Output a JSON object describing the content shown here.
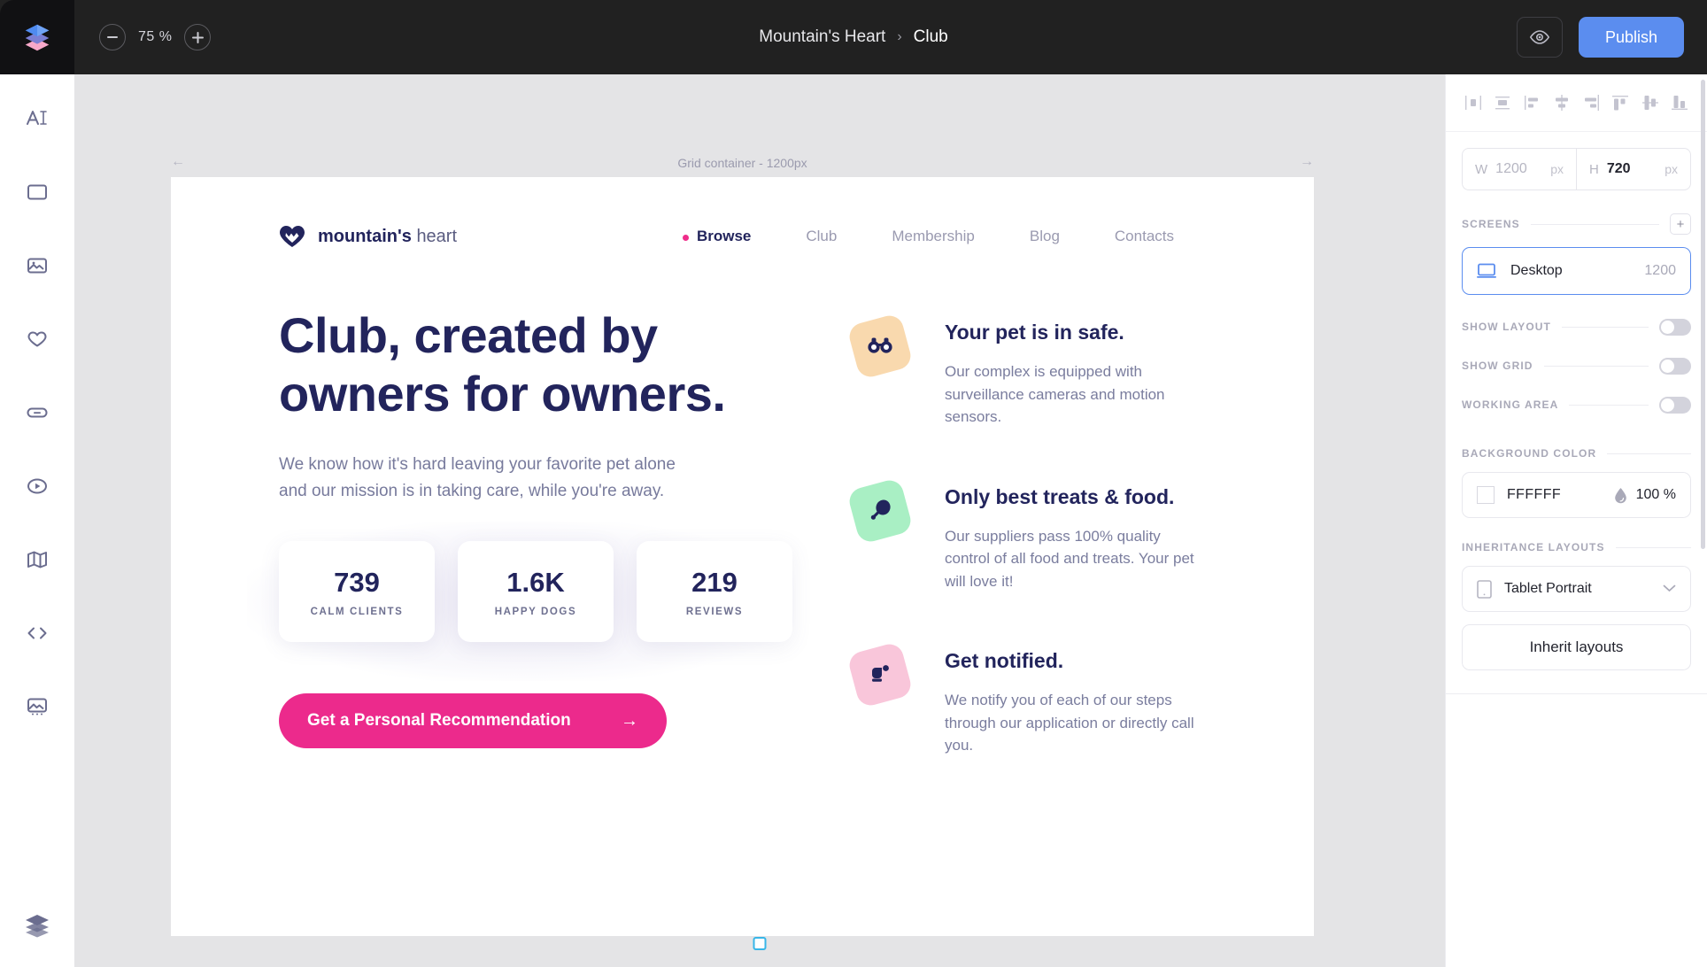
{
  "topbar": {
    "logo_icon": "layers-logo-icon",
    "zoom_out_icon": "minus-icon",
    "zoom_in_icon": "plus-icon",
    "zoom_value": "75 %",
    "breadcrumb_parent": "Mountain's Heart",
    "breadcrumb_separator": "›",
    "breadcrumb_current": "Club",
    "preview_icon": "eye-icon",
    "publish_label": "Publish"
  },
  "rail": {
    "items": [
      {
        "icon": "text-tool-icon",
        "name": "text"
      },
      {
        "icon": "block-tool-icon",
        "name": "block"
      },
      {
        "icon": "image-tool-icon",
        "name": "image"
      },
      {
        "icon": "shape-heart-tool-icon",
        "name": "shape"
      },
      {
        "icon": "button-tool-icon",
        "name": "button"
      },
      {
        "icon": "video-tool-icon",
        "name": "video"
      },
      {
        "icon": "map-tool-icon",
        "name": "map"
      },
      {
        "icon": "code-tool-icon",
        "name": "code"
      },
      {
        "icon": "gallery-tool-icon",
        "name": "gallery"
      }
    ],
    "bottom_icon": "layers-icon"
  },
  "canvas": {
    "ruler_label": "Grid container - 1200px",
    "arrow_left": "←",
    "arrow_right": "→"
  },
  "site": {
    "logo_mark": "heart-mountain-logo-icon",
    "logo_bold": "mountain's",
    "logo_light": "heart",
    "nav": [
      {
        "label": "Browse",
        "active": true
      },
      {
        "label": "Club",
        "active": false
      },
      {
        "label": "Membership",
        "active": false
      },
      {
        "label": "Blog",
        "active": false
      },
      {
        "label": "Contacts",
        "active": false
      }
    ],
    "hero": {
      "heading_line1": "Club, created by",
      "heading_line2": "owners for owners.",
      "paragraph": "We know how it's hard leaving your favorite pet alone and our mission is in taking care, while you're away.",
      "cta_label": "Get a Personal Recommendation",
      "cta_arrow": "→"
    },
    "stats": [
      {
        "number": "739",
        "label": "CALM CLIENTS"
      },
      {
        "number": "1.6K",
        "label": "HAPPY DOGS"
      },
      {
        "number": "219",
        "label": "REVIEWS"
      }
    ],
    "features": [
      {
        "icon": "binoculars-icon",
        "badge_color": "#f9d9ae",
        "title": "Your pet is in safe.",
        "desc": "Our complex is equipped with surveillance cameras and motion sensors."
      },
      {
        "icon": "drumstick-icon",
        "badge_color": "#a9efc4",
        "title": "Only best treats & food.",
        "desc": "Our suppliers pass 100% quality control of all food and treats. Your pet will love it!"
      },
      {
        "icon": "bell-notification-icon",
        "badge_color": "#f9c6da",
        "title": "Get notified.",
        "desc": "We notify you of each of our steps through our application or directly call you."
      }
    ]
  },
  "panel": {
    "align_icons": [
      "align-left-icon",
      "align-center-horizontal-icon",
      "align-right-icon",
      "distribute-horizontal-icon",
      "align-edge-right-icon",
      "align-top-icon",
      "align-middle-vertical-icon",
      "align-bottom-icon"
    ],
    "size": {
      "width_key": "W",
      "width_value": "1200",
      "width_unit": "px",
      "height_key": "H",
      "height_value": "720",
      "height_unit": "px"
    },
    "screens": {
      "title": "SCREENS",
      "add_icon": "plus-icon",
      "items": [
        {
          "icon": "desktop-icon",
          "name": "Desktop",
          "width": "1200"
        }
      ]
    },
    "toggles": [
      {
        "label": "SHOW LAYOUT",
        "on": false
      },
      {
        "label": "SHOW GRID",
        "on": false
      },
      {
        "label": "WORKING AREA",
        "on": false
      }
    ],
    "background": {
      "title": "BACKGROUND COLOR",
      "hex": "FFFFFF",
      "swatch_color": "#FFFFFF",
      "opacity_icon": "droplet-icon",
      "opacity": "100 %"
    },
    "inheritance": {
      "title": "INHERITANCE LAYOUTS",
      "select_icon": "tablet-portrait-icon",
      "select_value": "Tablet Portrait",
      "chevron_icon": "chevron-down-icon",
      "button_label": "Inherit layouts"
    }
  },
  "colors": {
    "accent_blue": "#5b8def",
    "accent_pink": "#ec2a8c",
    "navy": "#22245c",
    "topbar_bg": "#212121"
  }
}
